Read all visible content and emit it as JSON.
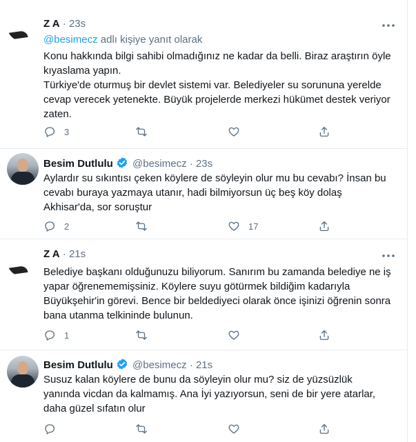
{
  "tweets": [
    {
      "name": "Z          A",
      "handle": "",
      "dot": "·",
      "time": "23s",
      "verified": false,
      "reply_prefix": "@besimecz",
      "reply_suffix": " adlı kişiye yanıt olarak",
      "text": "Konu hakkında bilgi sahibi olmadığınız ne kadar da belli. Biraz araştırın öyle kıyaslama yapın.\nTürkiye'de oturmuş bir devlet sistemi var. Belediyeler su sorununa yerelde cevap verecek yetenekte. Büyük projelerde merkezi hükümet destek veriyor zaten.",
      "reply_count": "3",
      "retweet_count": "",
      "like_count": ""
    },
    {
      "name": "Besim Dutlulu",
      "handle": "@besimecz",
      "dot": "·",
      "time": "23s",
      "verified": true,
      "text": "Aylardır su sıkıntısı çeken köylere de söyleyin olur mu bu cevabı? İnsan bu cevabı buraya yazmaya utanır, hadi bilmiyorsun üç beş köy dolaş Akhisar'da, sor soruştur",
      "reply_count": "2",
      "retweet_count": "",
      "like_count": "17"
    },
    {
      "name": "Z          A",
      "handle": "",
      "dot": "·",
      "time": "21s",
      "verified": false,
      "text": "Belediye başkanı olduğunuzu biliyorum. Sanırım bu zamanda belediye ne iş yapar öğrenememişsiniz. Köylere suyu götürmek bildiğim kadarıyla Büyükşehir'in görevi. Bence bir beldediyeci olarak önce işinizi öğrenin sonra bana utanma telkininde bulunun.",
      "reply_count": "1",
      "retweet_count": "",
      "like_count": ""
    },
    {
      "name": "Besim Dutlulu",
      "handle": "@besimecz",
      "dot": "·",
      "time": "21s",
      "verified": true,
      "text": "Susuz kalan köylere de bunu da söyleyin olur mu? siz de yüzsüzlük yanında vicdan da kalmamış. Ana İyi yazıyorsun, seni de bir yere atarlar, daha güzel sıfatın olur",
      "reply_count": "",
      "retweet_count": "",
      "like_count": ""
    }
  ],
  "colors": {
    "text": "#0f1419",
    "secondary": "#5b7083",
    "accent": "#1da1f2",
    "border": "#e6ecf0"
  },
  "icons": [
    "more-icon",
    "verified-icon",
    "reply-icon",
    "retweet-icon",
    "like-icon",
    "share-icon"
  ]
}
